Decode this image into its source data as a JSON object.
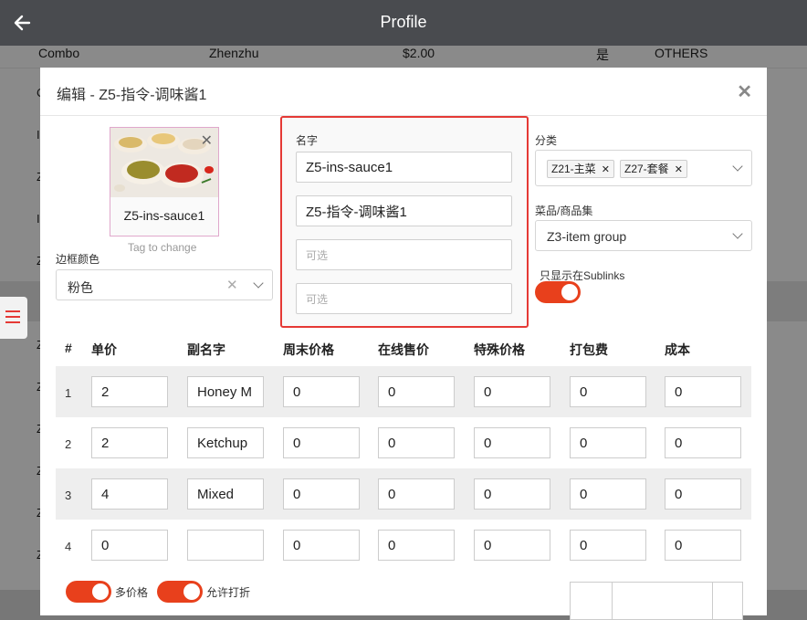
{
  "header": {
    "title": "Profile",
    "back_icon": "arrow-left-icon"
  },
  "background_list": {
    "row": [
      "Combo",
      "Zhenzhu",
      "$2.00",
      "是",
      "OTHERS"
    ],
    "left_letters": [
      "C",
      "I",
      "Z",
      "I",
      "Z",
      "Z",
      "Z",
      "Z",
      "Z",
      "Z",
      "Z"
    ]
  },
  "modal": {
    "title": "编辑 - Z5-指令-调味酱1",
    "close_icon": "close-icon",
    "image": {
      "label": "Z5-ins-sauce1",
      "tag_to_change": "Tag to change"
    },
    "border_color": {
      "label": "边框颜色",
      "value": "粉色"
    },
    "name": {
      "label": "名字",
      "value_en": "Z5-ins-sauce1",
      "value_zh": "Z5-指令-调味酱1",
      "placeholder_1": "可选",
      "placeholder_2": "可选"
    },
    "category": {
      "label": "分类",
      "tags": [
        "Z21-主菜",
        "Z27-套餐"
      ]
    },
    "item_group": {
      "label": "菜品/商品集",
      "value": "Z3-item group"
    },
    "sublinks_only": {
      "label": "只显示在Sublinks",
      "on": true
    },
    "table": {
      "headers": [
        "#",
        "单价",
        "副名字",
        "周末价格",
        "在线售价",
        "特殊价格",
        "打包费",
        "成本"
      ],
      "rows": [
        {
          "num": "1",
          "price": "2",
          "subname": "Honey M",
          "weekend": "0",
          "online": "0",
          "special": "0",
          "packing": "0",
          "cost": "0"
        },
        {
          "num": "2",
          "price": "2",
          "subname": "Ketchup",
          "weekend": "0",
          "online": "0",
          "special": "0",
          "packing": "0",
          "cost": "0"
        },
        {
          "num": "3",
          "price": "4",
          "subname": "Mixed",
          "weekend": "0",
          "online": "0",
          "special": "0",
          "packing": "0",
          "cost": "0"
        },
        {
          "num": "4",
          "price": "0",
          "subname": "",
          "weekend": "0",
          "online": "0",
          "special": "0",
          "packing": "0",
          "cost": "0"
        }
      ]
    },
    "bottom": {
      "toggle1_label": "多价格",
      "toggle2_label": "允许打折"
    }
  },
  "colors": {
    "accent": "#e8401c",
    "highlight_border": "#e53935",
    "topbar": "#494b4f"
  }
}
